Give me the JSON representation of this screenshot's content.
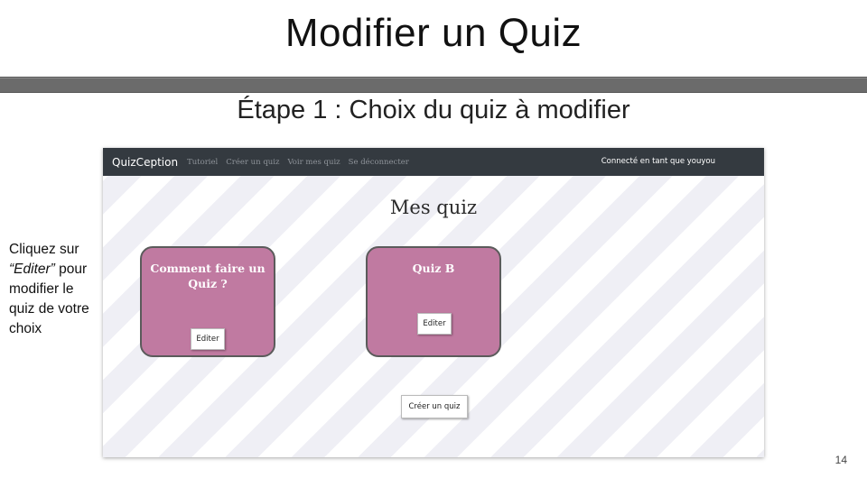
{
  "slide": {
    "title": "Modifier un Quiz",
    "subtitle": "Étape 1 : Choix du quiz à modifier",
    "page_number": "14"
  },
  "annotation": {
    "line1": "Cliquez sur",
    "editer_quoted": "“Editer”",
    "line2_rest": " pour",
    "line3": "modifier le",
    "line4": "quiz de votre",
    "line5": "choix"
  },
  "app": {
    "brand": "QuizCeption",
    "nav_links": [
      "Tutoriel",
      "Créer un quiz",
      "Voir mes quiz",
      "Se déconnecter"
    ],
    "user_status": "Connecté en tant que youyou",
    "page_heading": "Mes quiz",
    "quizzes": [
      {
        "title_line1": "Comment faire un",
        "title_line2": "Quiz ?",
        "edit_label": "Editer"
      },
      {
        "title_line1": "Quiz B",
        "title_line2": "",
        "edit_label": "Editer"
      }
    ],
    "create_button": "Créer un quiz",
    "colors": {
      "navbar": "#343a40",
      "card": "#c07aa1",
      "arrow": "#e8202a"
    }
  }
}
